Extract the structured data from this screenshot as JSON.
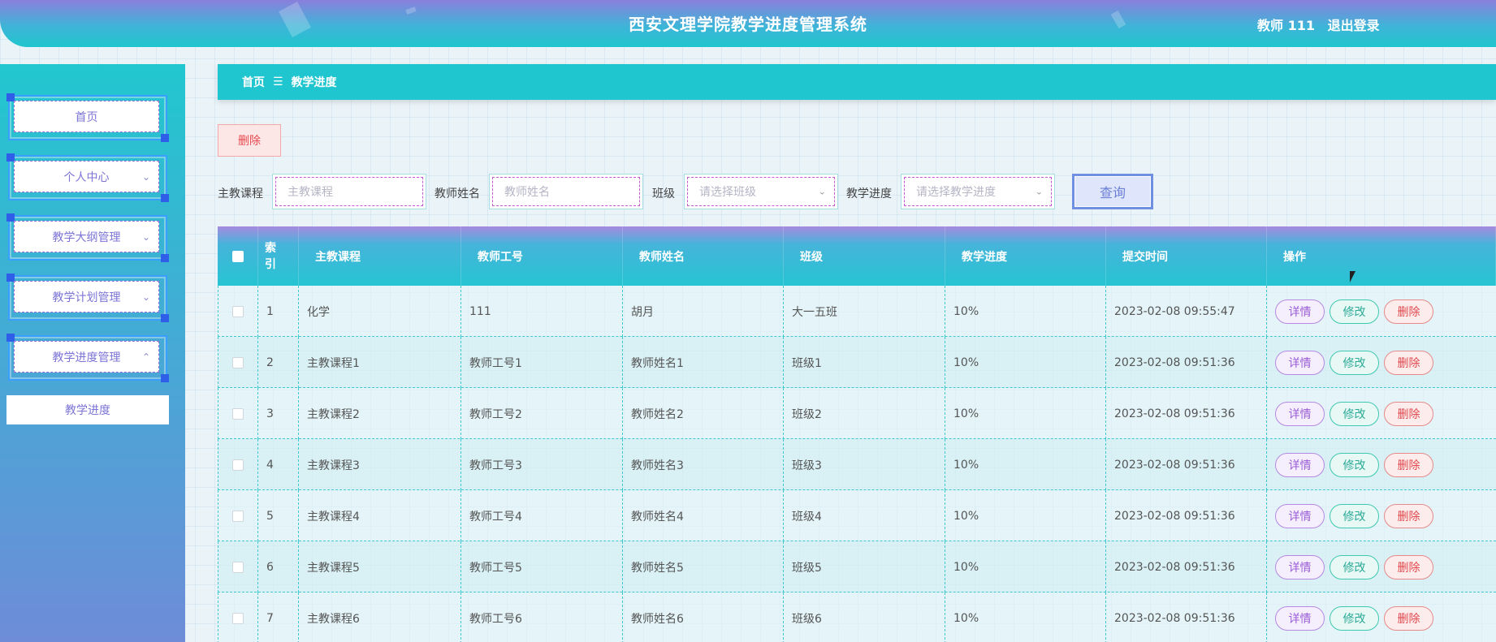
{
  "header": {
    "title": "西安文理学院教学进度管理系统",
    "user": "教师 111",
    "logout": "退出登录"
  },
  "sidebar": {
    "items": [
      {
        "label": "首页",
        "icon": ""
      },
      {
        "label": "个人中心",
        "icon": "chevron-down"
      },
      {
        "label": "教学大纲管理",
        "icon": "chevron-down"
      },
      {
        "label": "教学计划管理",
        "icon": "chevron-down"
      },
      {
        "label": "教学进度管理",
        "icon": "chevron-up"
      }
    ],
    "submenu": {
      "label": "教学进度"
    }
  },
  "breadcrumb": {
    "home": "首页",
    "separator": "☰",
    "current": "教学进度"
  },
  "toolbar": {
    "delete_label": "删除"
  },
  "search": {
    "course_label": "主教课程",
    "course_placeholder": "主教课程",
    "teacher_label": "教师姓名",
    "teacher_placeholder": "教师姓名",
    "class_label": "班级",
    "class_placeholder": "请选择班级",
    "progress_label": "教学进度",
    "progress_placeholder": "请选择教学进度",
    "query_label": "查询"
  },
  "table": {
    "headers": {
      "index_line1": "索",
      "index_line2": "引",
      "course": "主教课程",
      "teacher_id": "教师工号",
      "teacher_name": "教师姓名",
      "class": "班级",
      "progress": "教学进度",
      "submit_time": "提交时间",
      "actions": "操作"
    },
    "actions": {
      "detail": "详情",
      "edit": "修改",
      "delete": "删除"
    },
    "rows": [
      {
        "index": "1",
        "course": "化学",
        "teacher_id": "111",
        "teacher_name": "胡月",
        "class": "大一五班",
        "progress": "10%",
        "submit_time": "2023-02-08 09:55:47"
      },
      {
        "index": "2",
        "course": "主教课程1",
        "teacher_id": "教师工号1",
        "teacher_name": "教师姓名1",
        "class": "班级1",
        "progress": "10%",
        "submit_time": "2023-02-08 09:51:36"
      },
      {
        "index": "3",
        "course": "主教课程2",
        "teacher_id": "教师工号2",
        "teacher_name": "教师姓名2",
        "class": "班级2",
        "progress": "10%",
        "submit_time": "2023-02-08 09:51:36"
      },
      {
        "index": "4",
        "course": "主教课程3",
        "teacher_id": "教师工号3",
        "teacher_name": "教师姓名3",
        "class": "班级3",
        "progress": "10%",
        "submit_time": "2023-02-08 09:51:36"
      },
      {
        "index": "5",
        "course": "主教课程4",
        "teacher_id": "教师工号4",
        "teacher_name": "教师姓名4",
        "class": "班级4",
        "progress": "10%",
        "submit_time": "2023-02-08 09:51:36"
      },
      {
        "index": "6",
        "course": "主教课程5",
        "teacher_id": "教师工号5",
        "teacher_name": "教师姓名5",
        "class": "班级5",
        "progress": "10%",
        "submit_time": "2023-02-08 09:51:36"
      },
      {
        "index": "7",
        "course": "主教课程6",
        "teacher_id": "教师工号6",
        "teacher_name": "教师姓名6",
        "class": "班级6",
        "progress": "10%",
        "submit_time": "2023-02-08 09:51:36"
      }
    ]
  },
  "colors": {
    "accent": "#1fc6cf",
    "purple": "#8a7fdc",
    "danger": "#e0484d"
  }
}
